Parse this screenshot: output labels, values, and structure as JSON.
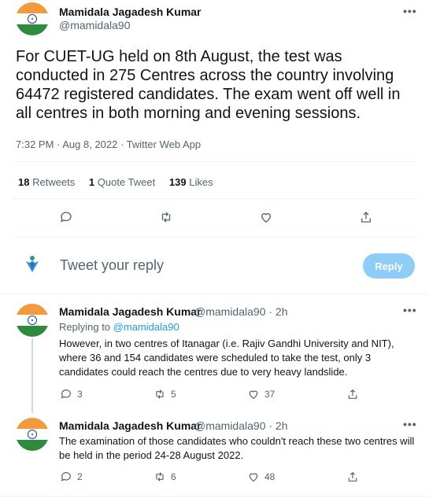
{
  "tweet": {
    "author_name": "Mamidala Jagadesh Kumar",
    "author_handle": "@mamidala90",
    "text": "For CUET-UG held on 8th August, the test was conducted in 275 Centres across the country involving 64472 registered candidates. The exam went off well in all centres in both morning and evening sessions.",
    "timestamp": "7:32 PM · Aug 8, 2022 · Twitter Web App",
    "more": "•••",
    "stats": {
      "retweets_count": "18",
      "retweets_label": "Retweets",
      "quotes_count": "1",
      "quotes_label": "Quote Tweet",
      "likes_count": "139",
      "likes_label": "Likes"
    }
  },
  "compose": {
    "placeholder": "Tweet your reply",
    "button_label": "Reply"
  },
  "replies": [
    {
      "author_name": "Mamidala Jagadesh Kumar",
      "handle_time": "@mamidala90 · 2h",
      "replying_prefix": "Replying to",
      "replying_handle": "@mamidala90",
      "text": "However, in two centres of Itanagar (i.e.  Rajiv Gandhi University and NIT), where 36 and  154 candidates were scheduled to take the test, only 3 candidates could reach the centres due to very heavy landslide.",
      "reply_count": "3",
      "retweet_count": "5",
      "like_count": "37",
      "more": "•••"
    },
    {
      "author_name": "Mamidala Jagadesh Kumar",
      "handle_time": "@mamidala90 · 2h",
      "text": "The examination of those candidates who couldn't reach these two centres will be held in the period 24-28 August 2022.",
      "reply_count": "2",
      "retweet_count": "6",
      "like_count": "48",
      "more": "•••"
    }
  ],
  "colors": {
    "text": "#0f1419",
    "secondary": "#536471",
    "link": "#1d9bf0",
    "reply_button": "#8ecdf7"
  }
}
